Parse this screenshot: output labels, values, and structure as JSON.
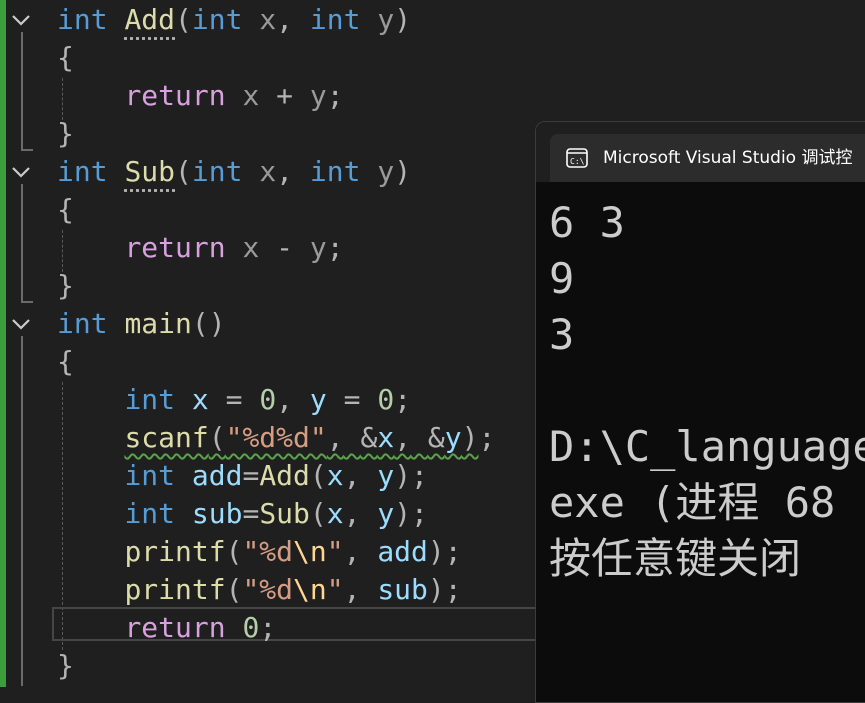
{
  "editor": {
    "lines": [
      {
        "id": "l1",
        "tokens": [
          [
            "kw",
            "int"
          ],
          [
            "plain",
            " "
          ],
          [
            "fn dots",
            "Add"
          ],
          [
            "punc",
            "("
          ],
          [
            "kw",
            "int"
          ],
          [
            "plain",
            " "
          ],
          [
            "param",
            "x"
          ],
          [
            "punc",
            ","
          ],
          [
            "plain",
            " "
          ],
          [
            "kw",
            "int"
          ],
          [
            "plain",
            " "
          ],
          [
            "param",
            "y"
          ],
          [
            "punc",
            ")"
          ]
        ]
      },
      {
        "id": "l2",
        "tokens": [
          [
            "punc",
            "{"
          ]
        ]
      },
      {
        "id": "l3",
        "tokens": [
          [
            "plain",
            "    "
          ],
          [
            "ctl",
            "return"
          ],
          [
            "plain",
            " "
          ],
          [
            "param",
            "x"
          ],
          [
            "plain",
            " "
          ],
          [
            "op",
            "+"
          ],
          [
            "plain",
            " "
          ],
          [
            "param",
            "y"
          ],
          [
            "punc",
            ";"
          ]
        ]
      },
      {
        "id": "l4",
        "tokens": [
          [
            "punc",
            "}"
          ]
        ]
      },
      {
        "id": "l5",
        "tokens": [
          [
            "kw",
            "int"
          ],
          [
            "plain",
            " "
          ],
          [
            "fn dots",
            "Sub"
          ],
          [
            "punc",
            "("
          ],
          [
            "kw",
            "int"
          ],
          [
            "plain",
            " "
          ],
          [
            "param",
            "x"
          ],
          [
            "punc",
            ","
          ],
          [
            "plain",
            " "
          ],
          [
            "kw",
            "int"
          ],
          [
            "plain",
            " "
          ],
          [
            "param",
            "y"
          ],
          [
            "punc",
            ")"
          ]
        ]
      },
      {
        "id": "l6",
        "tokens": [
          [
            "punc",
            "{"
          ]
        ]
      },
      {
        "id": "l7",
        "tokens": [
          [
            "plain",
            "    "
          ],
          [
            "ctl",
            "return"
          ],
          [
            "plain",
            " "
          ],
          [
            "param",
            "x"
          ],
          [
            "plain",
            " "
          ],
          [
            "op",
            "-"
          ],
          [
            "plain",
            " "
          ],
          [
            "param",
            "y"
          ],
          [
            "punc",
            ";"
          ]
        ]
      },
      {
        "id": "l8",
        "tokens": [
          [
            "punc",
            "}"
          ]
        ]
      },
      {
        "id": "l9",
        "tokens": [
          [
            "kw",
            "int"
          ],
          [
            "plain",
            " "
          ],
          [
            "fn",
            "main"
          ],
          [
            "punc",
            "()"
          ]
        ]
      },
      {
        "id": "l10",
        "tokens": [
          [
            "punc",
            "{"
          ]
        ]
      },
      {
        "id": "l11",
        "tokens": [
          [
            "plain",
            "    "
          ],
          [
            "kw",
            "int"
          ],
          [
            "plain",
            " "
          ],
          [
            "var",
            "x"
          ],
          [
            "plain",
            " "
          ],
          [
            "op",
            "="
          ],
          [
            "plain",
            " "
          ],
          [
            "num",
            "0"
          ],
          [
            "punc",
            ","
          ],
          [
            "plain",
            " "
          ],
          [
            "var",
            "y"
          ],
          [
            "plain",
            " "
          ],
          [
            "op",
            "="
          ],
          [
            "plain",
            " "
          ],
          [
            "num",
            "0"
          ],
          [
            "punc",
            ";"
          ]
        ]
      },
      {
        "id": "l12",
        "tokens": [
          [
            "plain",
            "    "
          ],
          [
            "fn squig",
            "scanf"
          ],
          [
            "punc squig",
            "("
          ],
          [
            "str squig",
            "\"%d%d\""
          ],
          [
            "punc squig",
            ","
          ],
          [
            "plain squig",
            " "
          ],
          [
            "op squig",
            "&"
          ],
          [
            "var squig",
            "x"
          ],
          [
            "punc squig",
            ","
          ],
          [
            "plain squig",
            " "
          ],
          [
            "op squig",
            "&"
          ],
          [
            "var squig",
            "y"
          ],
          [
            "punc squig",
            ")"
          ],
          [
            "punc",
            ";"
          ]
        ]
      },
      {
        "id": "l13",
        "tokens": [
          [
            "plain",
            "    "
          ],
          [
            "kw",
            "int"
          ],
          [
            "plain",
            " "
          ],
          [
            "var",
            "add"
          ],
          [
            "op",
            "="
          ],
          [
            "fn",
            "Add"
          ],
          [
            "punc",
            "("
          ],
          [
            "var",
            "x"
          ],
          [
            "punc",
            ","
          ],
          [
            "plain",
            " "
          ],
          [
            "var",
            "y"
          ],
          [
            "punc",
            ")"
          ],
          [
            "punc",
            ";"
          ]
        ]
      },
      {
        "id": "l14",
        "tokens": [
          [
            "plain",
            "    "
          ],
          [
            "kw",
            "int"
          ],
          [
            "plain",
            " "
          ],
          [
            "var",
            "sub"
          ],
          [
            "op",
            "="
          ],
          [
            "fn",
            "Sub"
          ],
          [
            "punc",
            "("
          ],
          [
            "var",
            "x"
          ],
          [
            "punc",
            ","
          ],
          [
            "plain",
            " "
          ],
          [
            "var",
            "y"
          ],
          [
            "punc",
            ")"
          ],
          [
            "punc",
            ";"
          ]
        ]
      },
      {
        "id": "l15",
        "tokens": [
          [
            "plain",
            "    "
          ],
          [
            "fn",
            "printf"
          ],
          [
            "punc",
            "("
          ],
          [
            "str",
            "\"%d"
          ],
          [
            "esc",
            "\\n"
          ],
          [
            "str",
            "\""
          ],
          [
            "punc",
            ","
          ],
          [
            "plain",
            " "
          ],
          [
            "var",
            "add"
          ],
          [
            "punc",
            ")"
          ],
          [
            "punc",
            ";"
          ]
        ]
      },
      {
        "id": "l16",
        "tokens": [
          [
            "plain",
            "    "
          ],
          [
            "fn",
            "printf"
          ],
          [
            "punc",
            "("
          ],
          [
            "str",
            "\"%d"
          ],
          [
            "esc",
            "\\n"
          ],
          [
            "str",
            "\""
          ],
          [
            "punc",
            ","
          ],
          [
            "plain",
            " "
          ],
          [
            "var",
            "sub"
          ],
          [
            "punc",
            ")"
          ],
          [
            "punc",
            ";"
          ]
        ]
      },
      {
        "id": "l17",
        "tokens": [
          [
            "plain",
            "    "
          ],
          [
            "ctl",
            "return"
          ],
          [
            "plain",
            " "
          ],
          [
            "num",
            "0"
          ],
          [
            "punc",
            ";"
          ]
        ]
      },
      {
        "id": "l18",
        "tokens": [
          [
            "punc",
            "}"
          ]
        ]
      }
    ]
  },
  "console": {
    "title": "Microsoft Visual Studio 调试控",
    "icon": "terminal-icon",
    "output": [
      "6 3",
      "9",
      "3",
      "",
      "D:\\C_language",
      "exe (进程 68",
      "按任意键关闭"
    ]
  },
  "colors": {
    "editor_bg": "#1f1f1f",
    "gutter_change_bar": "#3a9e3a",
    "keyword": "#569cd6",
    "control": "#d8a0df",
    "function": "#dcdcaa",
    "variable": "#9cdcfe",
    "string": "#d69d85",
    "console_bg": "#0c0c0c"
  }
}
